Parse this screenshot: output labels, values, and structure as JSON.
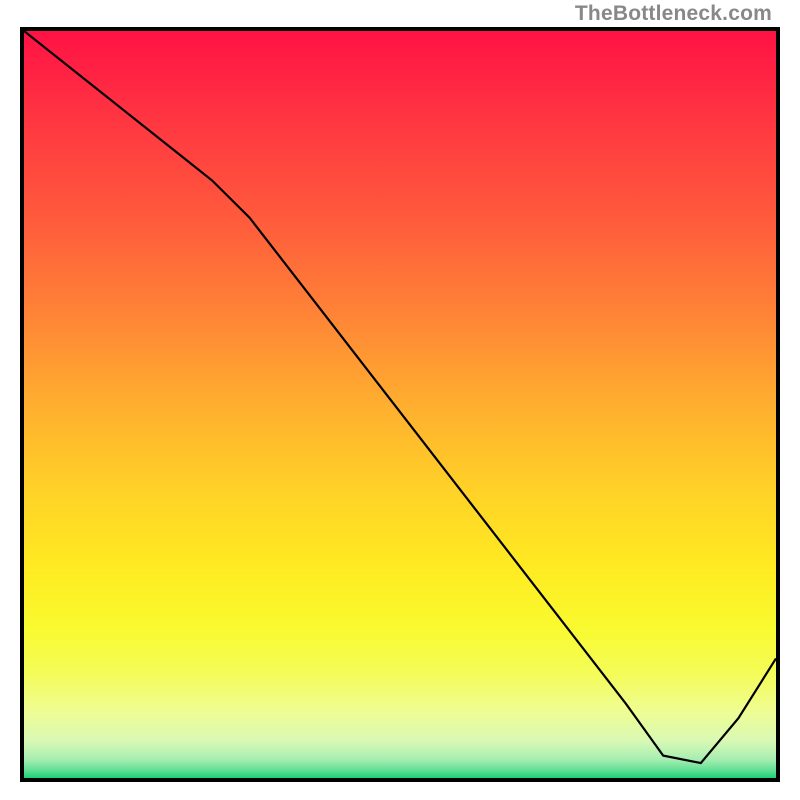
{
  "attribution": "TheBottleneck.com",
  "bottom_label": "",
  "chart_data": {
    "type": "line",
    "title": "",
    "xlabel": "",
    "ylabel": "",
    "xlim": [
      0,
      100
    ],
    "ylim": [
      0,
      100
    ],
    "series": [
      {
        "name": "curve",
        "x": [
          0,
          10,
          20,
          25,
          30,
          40,
          50,
          60,
          70,
          80,
          85,
          90,
          95,
          100
        ],
        "y": [
          100,
          92,
          84,
          80,
          75,
          62,
          49,
          36,
          23,
          10,
          3,
          2,
          8,
          16
        ]
      }
    ],
    "gradient_stops": [
      {
        "offset": 0.0,
        "color": "#ff1245"
      },
      {
        "offset": 0.12,
        "color": "#ff3641"
      },
      {
        "offset": 0.25,
        "color": "#ff5a3c"
      },
      {
        "offset": 0.38,
        "color": "#ff8436"
      },
      {
        "offset": 0.5,
        "color": "#ffae2f"
      },
      {
        "offset": 0.62,
        "color": "#ffd327"
      },
      {
        "offset": 0.72,
        "color": "#ffeb21"
      },
      {
        "offset": 0.8,
        "color": "#f9fa30"
      },
      {
        "offset": 0.86,
        "color": "#f4fc58"
      },
      {
        "offset": 0.91,
        "color": "#effd92"
      },
      {
        "offset": 0.95,
        "color": "#d9f9b4"
      },
      {
        "offset": 0.975,
        "color": "#a7eeb1"
      },
      {
        "offset": 0.99,
        "color": "#5fdf94"
      },
      {
        "offset": 1.0,
        "color": "#1bd176"
      }
    ],
    "bottom_label_x_frac": 0.83
  }
}
